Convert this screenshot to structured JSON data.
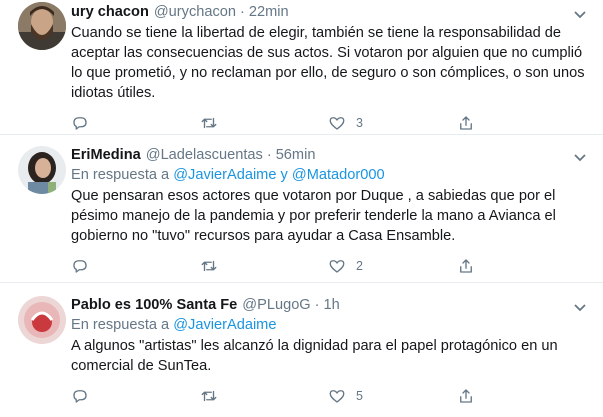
{
  "tweets": [
    {
      "name": "ury chacon",
      "handle": "@urychacon",
      "separator": "·",
      "time": "22min",
      "text": "Cuando se tiene la libertad de elegir, también se tiene la responsabilidad de aceptar las consecuencias de sus actos. Si votaron por alguien que no cumplió lo que prometió, y no reclaman por ello, de seguro o son cómplices, o son unos idiotas útiles.",
      "like_count": "3"
    },
    {
      "name": "EriMedina",
      "handle": "@Ladelascuentas",
      "separator": "·",
      "time": "56min",
      "reply_prefix": "En respuesta a",
      "reply_user1": "@JavierAdaime",
      "reply_joiner": "y",
      "reply_user2": "@Matador000",
      "text": "Que pensaran esos actores que votaron por Duque , a sabiedas que por el pésimo manejo de la pandemia y por preferir tenderle la mano a Avianca el gobierno no \"tuvo\" recursos para ayudar a Casa Ensamble.",
      "like_count": "2"
    },
    {
      "name": "Pablo es 100% Santa Fe",
      "handle": "@PLugoG",
      "separator": "·",
      "time": "1h",
      "reply_prefix": "En respuesta a",
      "reply_user1": "@JavierAdaime",
      "text": "A algunos \"artistas\" les alcanzó la dignidad para el papel protagónico en un comercial de SunTea.",
      "like_count": "5"
    }
  ],
  "icons": {
    "reply": "reply-icon",
    "retweet": "retweet-icon",
    "like": "heart-icon",
    "share": "share-icon",
    "more": "chevron-down-icon"
  },
  "colors": {
    "link": "#1b95e0",
    "secondary_text": "#657786",
    "divider": "#e6ecf0"
  }
}
